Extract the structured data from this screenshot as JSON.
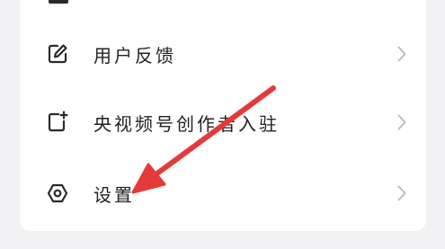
{
  "menu": {
    "items": [
      {
        "label": "用户反馈",
        "icon": "feedback-edit-icon"
      },
      {
        "label": "央视频号创作者入驻",
        "icon": "add-creator-icon"
      },
      {
        "label": "设置",
        "icon": "settings-gear-icon"
      }
    ]
  },
  "colors": {
    "background": "#f2f2f4",
    "card": "#ffffff",
    "text": "#222222",
    "chevron": "#b8b8b8",
    "annotation_arrow": "#e53a3a"
  }
}
